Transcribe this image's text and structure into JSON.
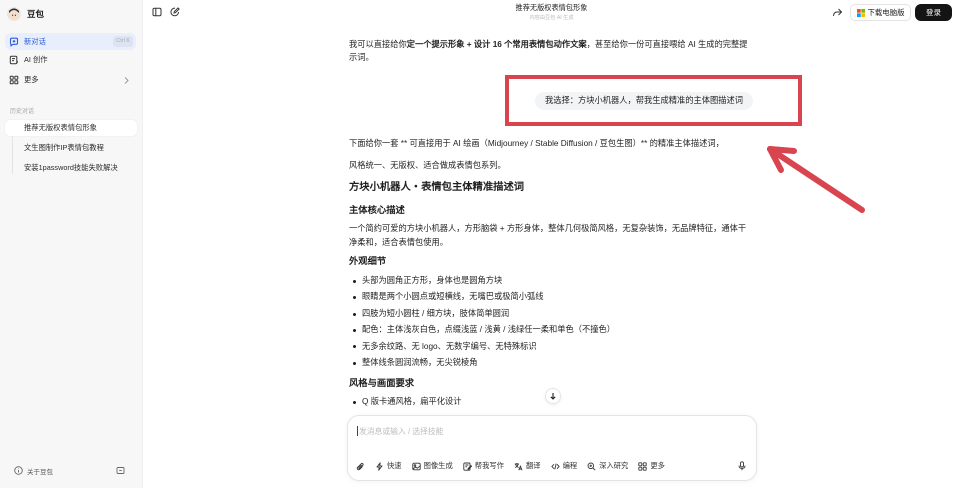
{
  "app": {
    "name": "豆包"
  },
  "colors": {
    "accent": "#2a5bd7",
    "annotation": "#d8454f",
    "login_button": "#141414"
  },
  "sidebar": {
    "nav": [
      {
        "label": "新对话",
        "shortcut": "Ctrl K",
        "icon": "new-chat-icon",
        "active": true
      },
      {
        "label": "AI 创作",
        "icon": "ai-create-icon"
      },
      {
        "label": "更多",
        "icon": "grid-icon"
      }
    ],
    "history_label": "历史对话",
    "history": [
      {
        "label": "推荐无版权表情包形象",
        "active": true
      },
      {
        "label": "文生图制作IP表情包教程"
      },
      {
        "label": "安装1password技能失败解决"
      }
    ],
    "footer": {
      "about": "关于豆包"
    }
  },
  "header": {
    "title": "推荐无版权表情包形象",
    "subtitle": "内容由豆包 AI 生成",
    "download": "下载电脑版",
    "login": "登录"
  },
  "chat": {
    "intro": {
      "pre": "我可以直接给你",
      "bold": "定一个提示形象 + 设计 16 个常用表情包动作文案",
      "post": "，甚至给你一份可直接喂给 AI 生成的完整提示词。"
    },
    "user_message": "我选择：方块小机器人，帮我生成精准的主体图描述词",
    "reply_intro": "下面给你一套 ** 可直接用于 AI 绘画（Midjourney / Stable Diffusion / 豆包生图）** 的精准主体描述词，",
    "reply_style": "风格统一、无版权、适合做成表情包系列。",
    "heading": "方块小机器人・表情包主体精准描述词",
    "sections": [
      {
        "title": "主体核心描述",
        "paragraph": "一个简约可爱的方块小机器人，方形脑袋 + 方形身体，整体几何极简风格，无复杂装饰，无品牌特征，通体干净柔和，适合表情包使用。"
      },
      {
        "title": "外观细节",
        "bullets": [
          "头部为圆角正方形，身体也是圆角方块",
          "眼睛是两个小圆点或短横线，无嘴巴或极简小弧线",
          "四肢为短小圆柱 / 细方块，肢体简单圆润",
          "配色：主体浅灰白色，点缀浅蓝 / 浅黄 / 浅绿任一柔和单色（不撞色）",
          "无多余纹路、无 logo、无数字编号、无特殊标识",
          "整体线条圆润流畅，无尖锐棱角"
        ]
      },
      {
        "title": "风格与画面要求",
        "bullets": [
          "Q 版卡通风格，扁平化设计"
        ]
      }
    ]
  },
  "composer": {
    "placeholder": "发消息或输入 / 选择技能",
    "tools": [
      {
        "label": "快速",
        "icon": "lightning-icon"
      },
      {
        "label": "图像生成",
        "icon": "image-icon"
      },
      {
        "label": "帮我写作",
        "icon": "pen-icon"
      },
      {
        "label": "翻译",
        "icon": "translate-icon"
      },
      {
        "label": "编程",
        "icon": "code-icon"
      },
      {
        "label": "深入研究",
        "icon": "research-icon"
      },
      {
        "label": "更多",
        "icon": "grid-icon"
      }
    ]
  }
}
